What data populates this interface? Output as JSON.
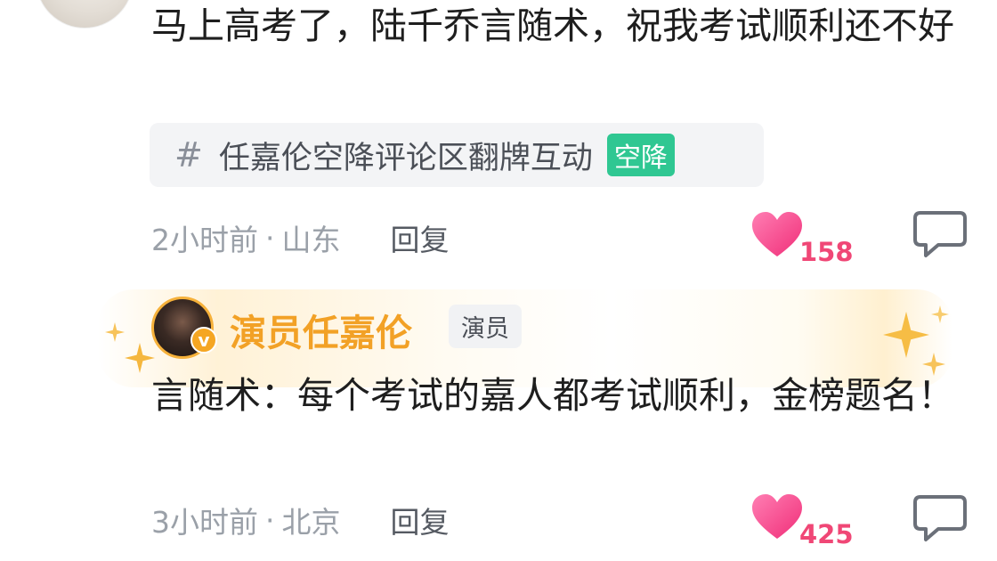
{
  "comments": [
    {
      "text": "马上高考了，陆千乔言随术，祝我考试顺利还不好",
      "topic": {
        "hash": "#",
        "label": "任嘉伦空降评论区翻牌互动",
        "tag": "空降"
      },
      "time": "2小时前",
      "separator": "·",
      "location": "山东",
      "reply_label": "回复",
      "likes": "158"
    },
    {
      "author": "演员任嘉伦",
      "author_badge": "v",
      "role_tag": "演员",
      "text": "言随术：每个考试的嘉人都考试顺利，金榜题名！",
      "time": "3小时前",
      "separator": "·",
      "location": "北京",
      "reply_label": "回复",
      "likes": "425"
    }
  ],
  "colors": {
    "like": "#f04776",
    "verified_name": "#f2a126",
    "topic_tag": "#2fc792",
    "meta_text": "#9aa0a8"
  },
  "icons": {
    "like": "heart-icon",
    "comment": "comment-bubble-icon",
    "hash": "hash-icon",
    "verified": "verified-v-icon",
    "sparkle": "sparkle-icon"
  }
}
